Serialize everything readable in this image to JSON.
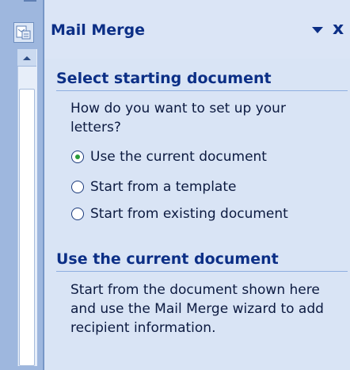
{
  "pane": {
    "title": "Mail Merge",
    "menu_icon": "dropdown-arrow-icon",
    "close_label": "x"
  },
  "section1": {
    "title": "Select starting document",
    "question": "How do you want to set up your letters?",
    "options": [
      {
        "label": "Use the current document",
        "checked": true
      },
      {
        "label": "Start from a template",
        "checked": false
      },
      {
        "label": "Start from existing document",
        "checked": false
      }
    ]
  },
  "section2": {
    "title": "Use the current document",
    "description": "Start from the document shown here and use the Mail Merge wizard to add recipient information."
  },
  "colors": {
    "accent_text": "#0c2f86",
    "pane_background": "#d9e4f5",
    "radio_selected": "#2a9b3a"
  }
}
